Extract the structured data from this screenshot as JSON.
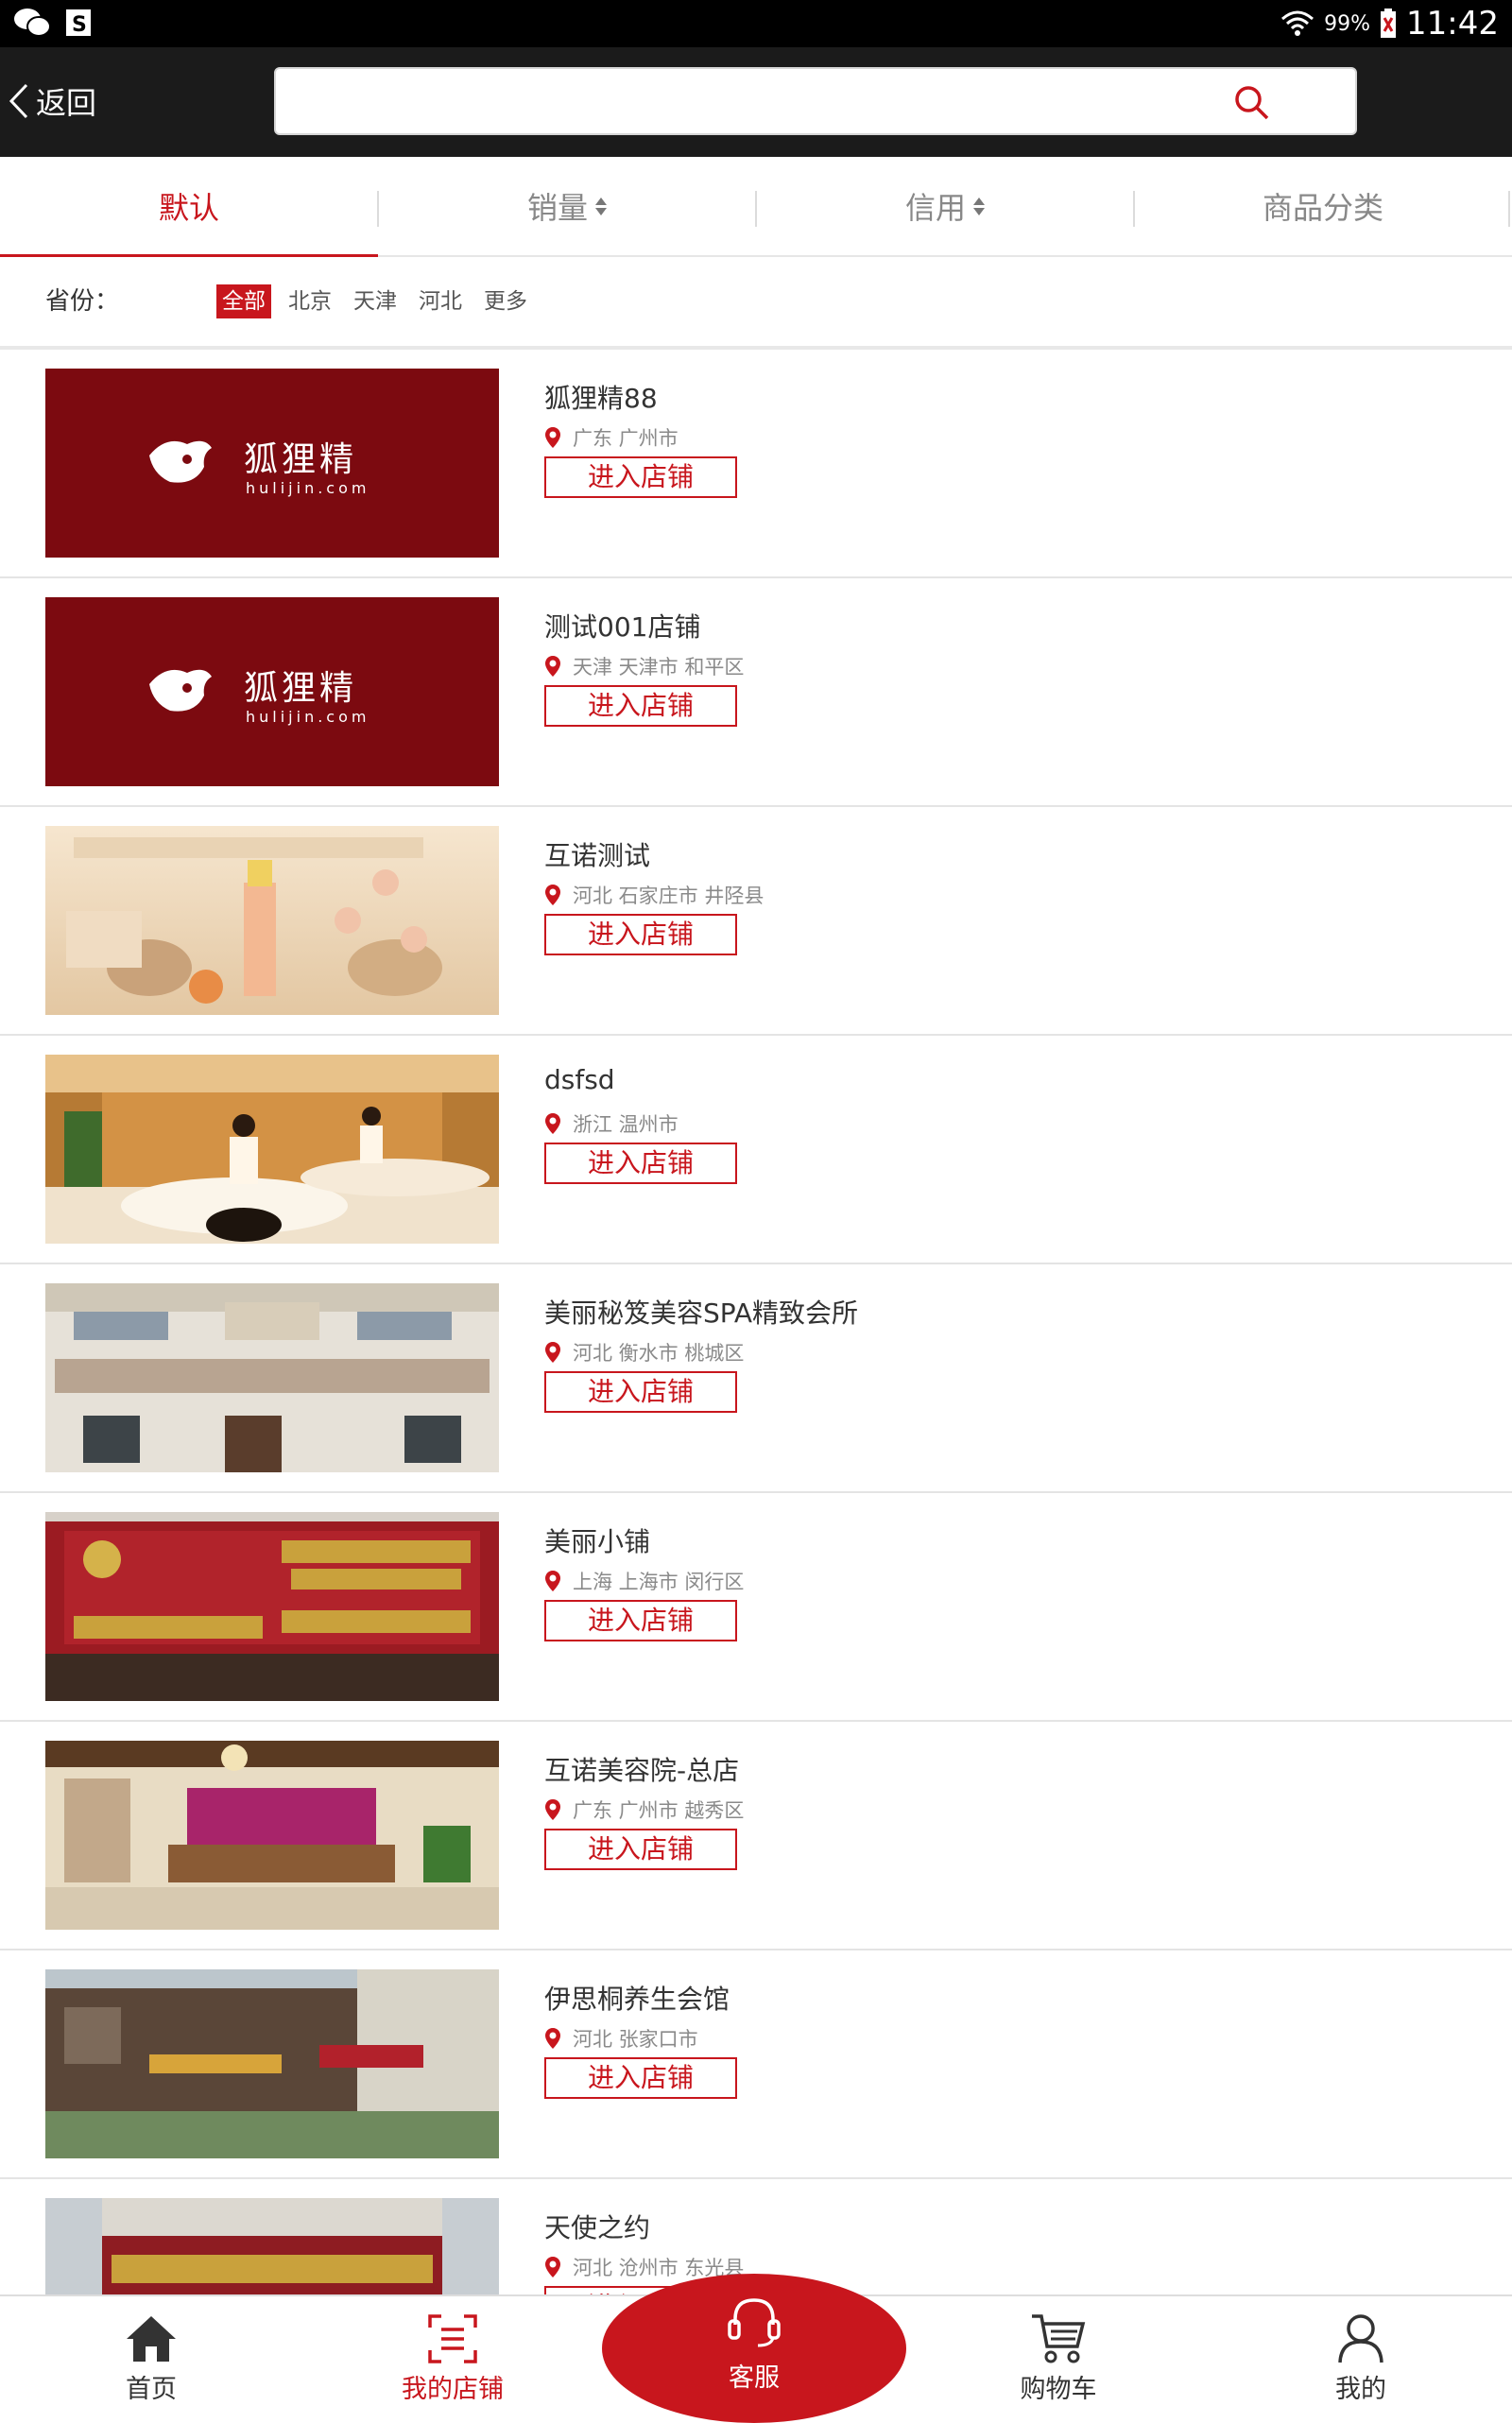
{
  "status_bar": {
    "battery": "99%",
    "time": "11:42"
  },
  "header": {
    "back_label": "返回",
    "search_placeholder": ""
  },
  "sort_tabs": [
    {
      "label": "默认",
      "active": true
    },
    {
      "label": "销量",
      "active": false
    },
    {
      "label": "信用",
      "active": false
    },
    {
      "label": "商品分类",
      "active": false
    }
  ],
  "province_filter": {
    "label": "省份：",
    "options": [
      "全部",
      "北京",
      "天津",
      "河北",
      "更多"
    ],
    "selected": "全部"
  },
  "enter_label": "进入店铺",
  "stores": [
    {
      "name": "狐狸精88",
      "location": "广东 广州市",
      "image": "hulijin-logo"
    },
    {
      "name": "测试001店铺",
      "location": "天津 天津市 和平区",
      "image": "hulijin-logo"
    },
    {
      "name": "互诺测试",
      "location": "河北 石家庄市 井陉县",
      "image": "cosmetics-ad"
    },
    {
      "name": "dsfsd",
      "location": "浙江 温州市",
      "image": "spa-room"
    },
    {
      "name": "美丽秘笈美容SPA精致会所",
      "location": "河北 衡水市 桃城区",
      "image": "storefront"
    },
    {
      "name": "美丽小铺",
      "location": "上海 上海市 闵行区",
      "image": "shop-sign"
    },
    {
      "name": "互诺美容院-总店",
      "location": "广东 广州市 越秀区",
      "image": "salon-lobby"
    },
    {
      "name": "伊思桐养生会馆",
      "location": "河北 张家口市",
      "image": "building-facade"
    },
    {
      "name": "天使之约",
      "location": "河北 沧州市 东光县",
      "image": "building-front"
    }
  ],
  "logo": {
    "cn": "狐狸精",
    "en": "hulijin.com"
  },
  "bottom_nav": [
    {
      "label": "首页",
      "active": false
    },
    {
      "label": "我的店铺",
      "active": true
    },
    {
      "label": "客服",
      "active": false
    },
    {
      "label": "购物车",
      "active": false
    },
    {
      "label": "我的",
      "active": false
    }
  ],
  "colors": {
    "accent": "#c8161d",
    "header_bg": "#1b1b1b",
    "logo_bg": "#7c0a10"
  }
}
